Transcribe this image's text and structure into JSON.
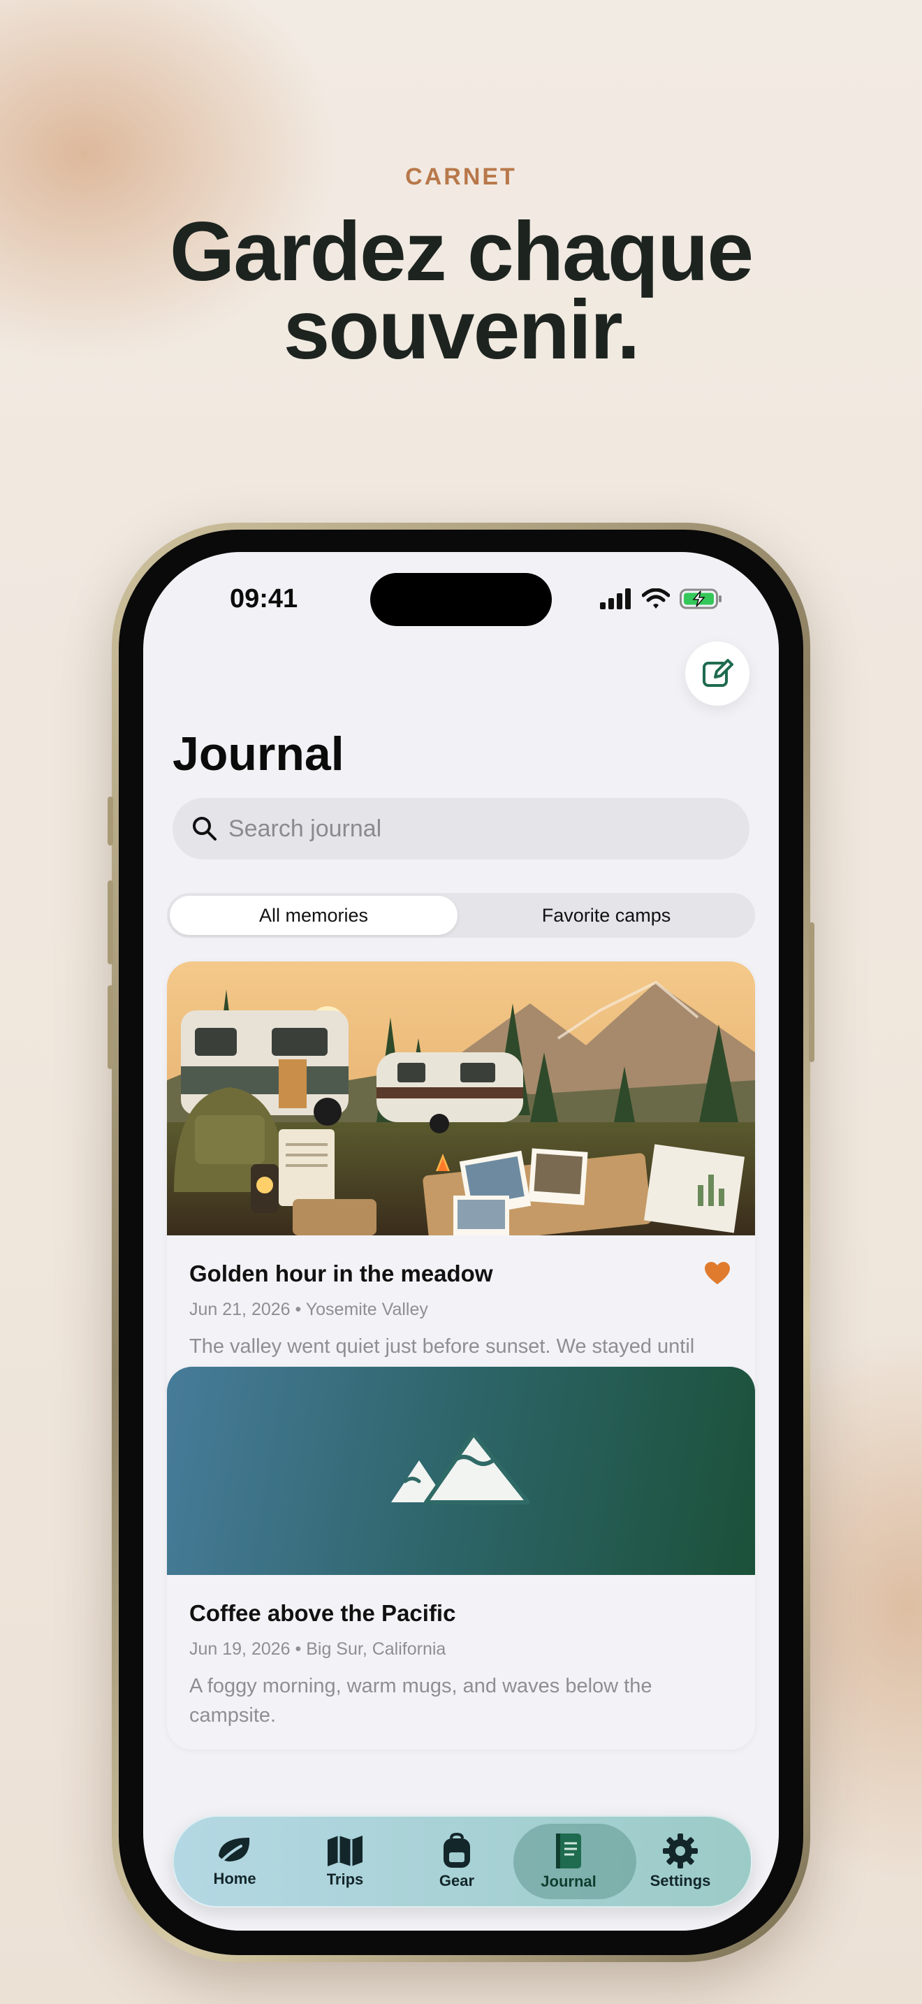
{
  "hero": {
    "eyebrow": "CARNET",
    "headline_line1": "Gardez chaque",
    "headline_line2": "souvenir."
  },
  "status_bar": {
    "time": "09:41",
    "icons": [
      "cellular-signal-icon",
      "wifi-icon",
      "battery-charging-icon"
    ]
  },
  "header": {
    "title": "Journal",
    "compose_icon": "compose-icon"
  },
  "search": {
    "placeholder": "Search journal",
    "icon": "search-icon"
  },
  "segments": {
    "items": [
      "All memories",
      "Favorite camps"
    ],
    "selected": "All memories"
  },
  "entries": [
    {
      "title": "Golden hour in the meadow",
      "date": "Jun 21, 2026",
      "location": "Yosemite Valley",
      "meta": "Jun 21, 2026 • Yosemite Valley",
      "body": "The valley went quiet just before sunset. We stayed until the last light left Half Dome.",
      "favorite": true
    },
    {
      "title": "Coffee above the Pacific",
      "date": "Jun 19, 2026",
      "location": "Big Sur, California",
      "meta": "Jun 19, 2026 • Big Sur, California",
      "body": "A foggy morning, warm mugs, and waves below the campsite.",
      "favorite": false
    }
  ],
  "tab_bar": {
    "tabs": [
      {
        "label": "Home",
        "icon": "leaf-icon"
      },
      {
        "label": "Trips",
        "icon": "map-icon"
      },
      {
        "label": "Gear",
        "icon": "backpack-icon"
      },
      {
        "label": "Journal",
        "icon": "notebook-icon"
      },
      {
        "label": "Settings",
        "icon": "gear-icon"
      }
    ],
    "selected": "Journal"
  },
  "colors": {
    "accent": "#b8784a",
    "heart": "#e07b2e",
    "brand_green": "#1f6b4f"
  }
}
